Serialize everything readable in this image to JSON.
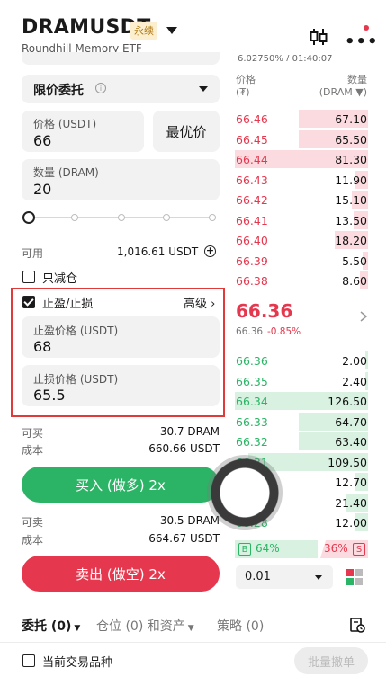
{
  "header": {
    "symbol": "DRAMUSDT",
    "badge": "永续",
    "subtitle": "Roundhill Memory ETF",
    "ticker_fragment": "6.02750% / 01:40:07"
  },
  "order_form": {
    "order_type": "限价委托",
    "price_label": "价格 (USDT)",
    "price_value": "66",
    "best_price_button": "最优价",
    "qty_label": "数量 (DRAM)",
    "qty_value": "20",
    "slider_percent": 0,
    "available_label": "可用",
    "available_value": "1,016.61 USDT",
    "reduce_only_label": "只减仓",
    "tpsl_label": "止盈/止损",
    "tpsl_checked": true,
    "advanced_label": "高级 ›",
    "tp_label": "止盈价格 (USDT)",
    "tp_value": "68",
    "sl_label": "止损价格 (USDT)",
    "sl_value": "65.5",
    "buy_max_label": "可买",
    "buy_max_value": "30.7 DRAM",
    "buy_cost_label": "成本",
    "buy_cost_value": "660.66 USDT",
    "buy_button": "买入 (做多) 2x",
    "sell_max_label": "可卖",
    "sell_max_value": "30.5 DRAM",
    "sell_cost_label": "成本",
    "sell_cost_value": "664.67 USDT",
    "sell_button": "卖出 (做空) 2x"
  },
  "order_book": {
    "price_header": "价格",
    "price_unit": "(₮)",
    "qty_header": "数量",
    "qty_unit": "(DRAM ▼)",
    "asks": [
      {
        "price": "66.46",
        "qty": "67.10",
        "depth": 0.52
      },
      {
        "price": "66.45",
        "qty": "65.50",
        "depth": 0.52
      },
      {
        "price": "66.44",
        "qty": "81.30",
        "depth": 1.0
      },
      {
        "price": "66.43",
        "qty": "11.90",
        "depth": 0.1
      },
      {
        "price": "66.42",
        "qty": "15.10",
        "depth": 0.12
      },
      {
        "price": "66.41",
        "qty": "13.50",
        "depth": 0.11
      },
      {
        "price": "66.40",
        "qty": "18.20",
        "depth": 0.25
      },
      {
        "price": "66.39",
        "qty": "5.50",
        "depth": 0.04
      },
      {
        "price": "66.38",
        "qty": "8.60",
        "depth": 0.06
      }
    ],
    "last_price": "66.36",
    "last_sub": "66.36",
    "change_pct": "-0.85%",
    "bids": [
      {
        "price": "66.36",
        "qty": "2.00",
        "depth": 0.02
      },
      {
        "price": "66.35",
        "qty": "2.40",
        "depth": 0.02
      },
      {
        "price": "66.34",
        "qty": "126.50",
        "depth": 1.0
      },
      {
        "price": "66.33",
        "qty": "64.70",
        "depth": 0.52
      },
      {
        "price": "66.32",
        "qty": "63.40",
        "depth": 0.52
      },
      {
        "price": "66.31",
        "qty": "109.50",
        "depth": 0.9
      },
      {
        "price": "66.30",
        "qty": "12.70",
        "depth": 0.1
      },
      {
        "price": "66.29",
        "qty": "21.40",
        "depth": 0.17
      },
      {
        "price": "66.28",
        "qty": "12.00",
        "depth": 0.1
      }
    ],
    "buy_ratio_label": "B",
    "buy_ratio": "64%",
    "sell_ratio": "36%",
    "sell_ratio_label": "S",
    "depth_step": "0.01"
  },
  "tabs": {
    "orders": "委托 (0)",
    "positions": "仓位 (0) 和资产",
    "strategy": "策略 (0)"
  },
  "footer": {
    "current_pair_only": "当前交易品种",
    "batch_cancel": "批量撤单"
  },
  "colors": {
    "buy": "#2bb466",
    "sell": "#e5384e",
    "highlight_frame": "#e03a3a"
  },
  "icons": [
    "candlestick-chart-icon",
    "more-icon",
    "info-icon",
    "plus-circle-icon",
    "chevron-right-icon",
    "layout-icon",
    "order-history-icon"
  ]
}
